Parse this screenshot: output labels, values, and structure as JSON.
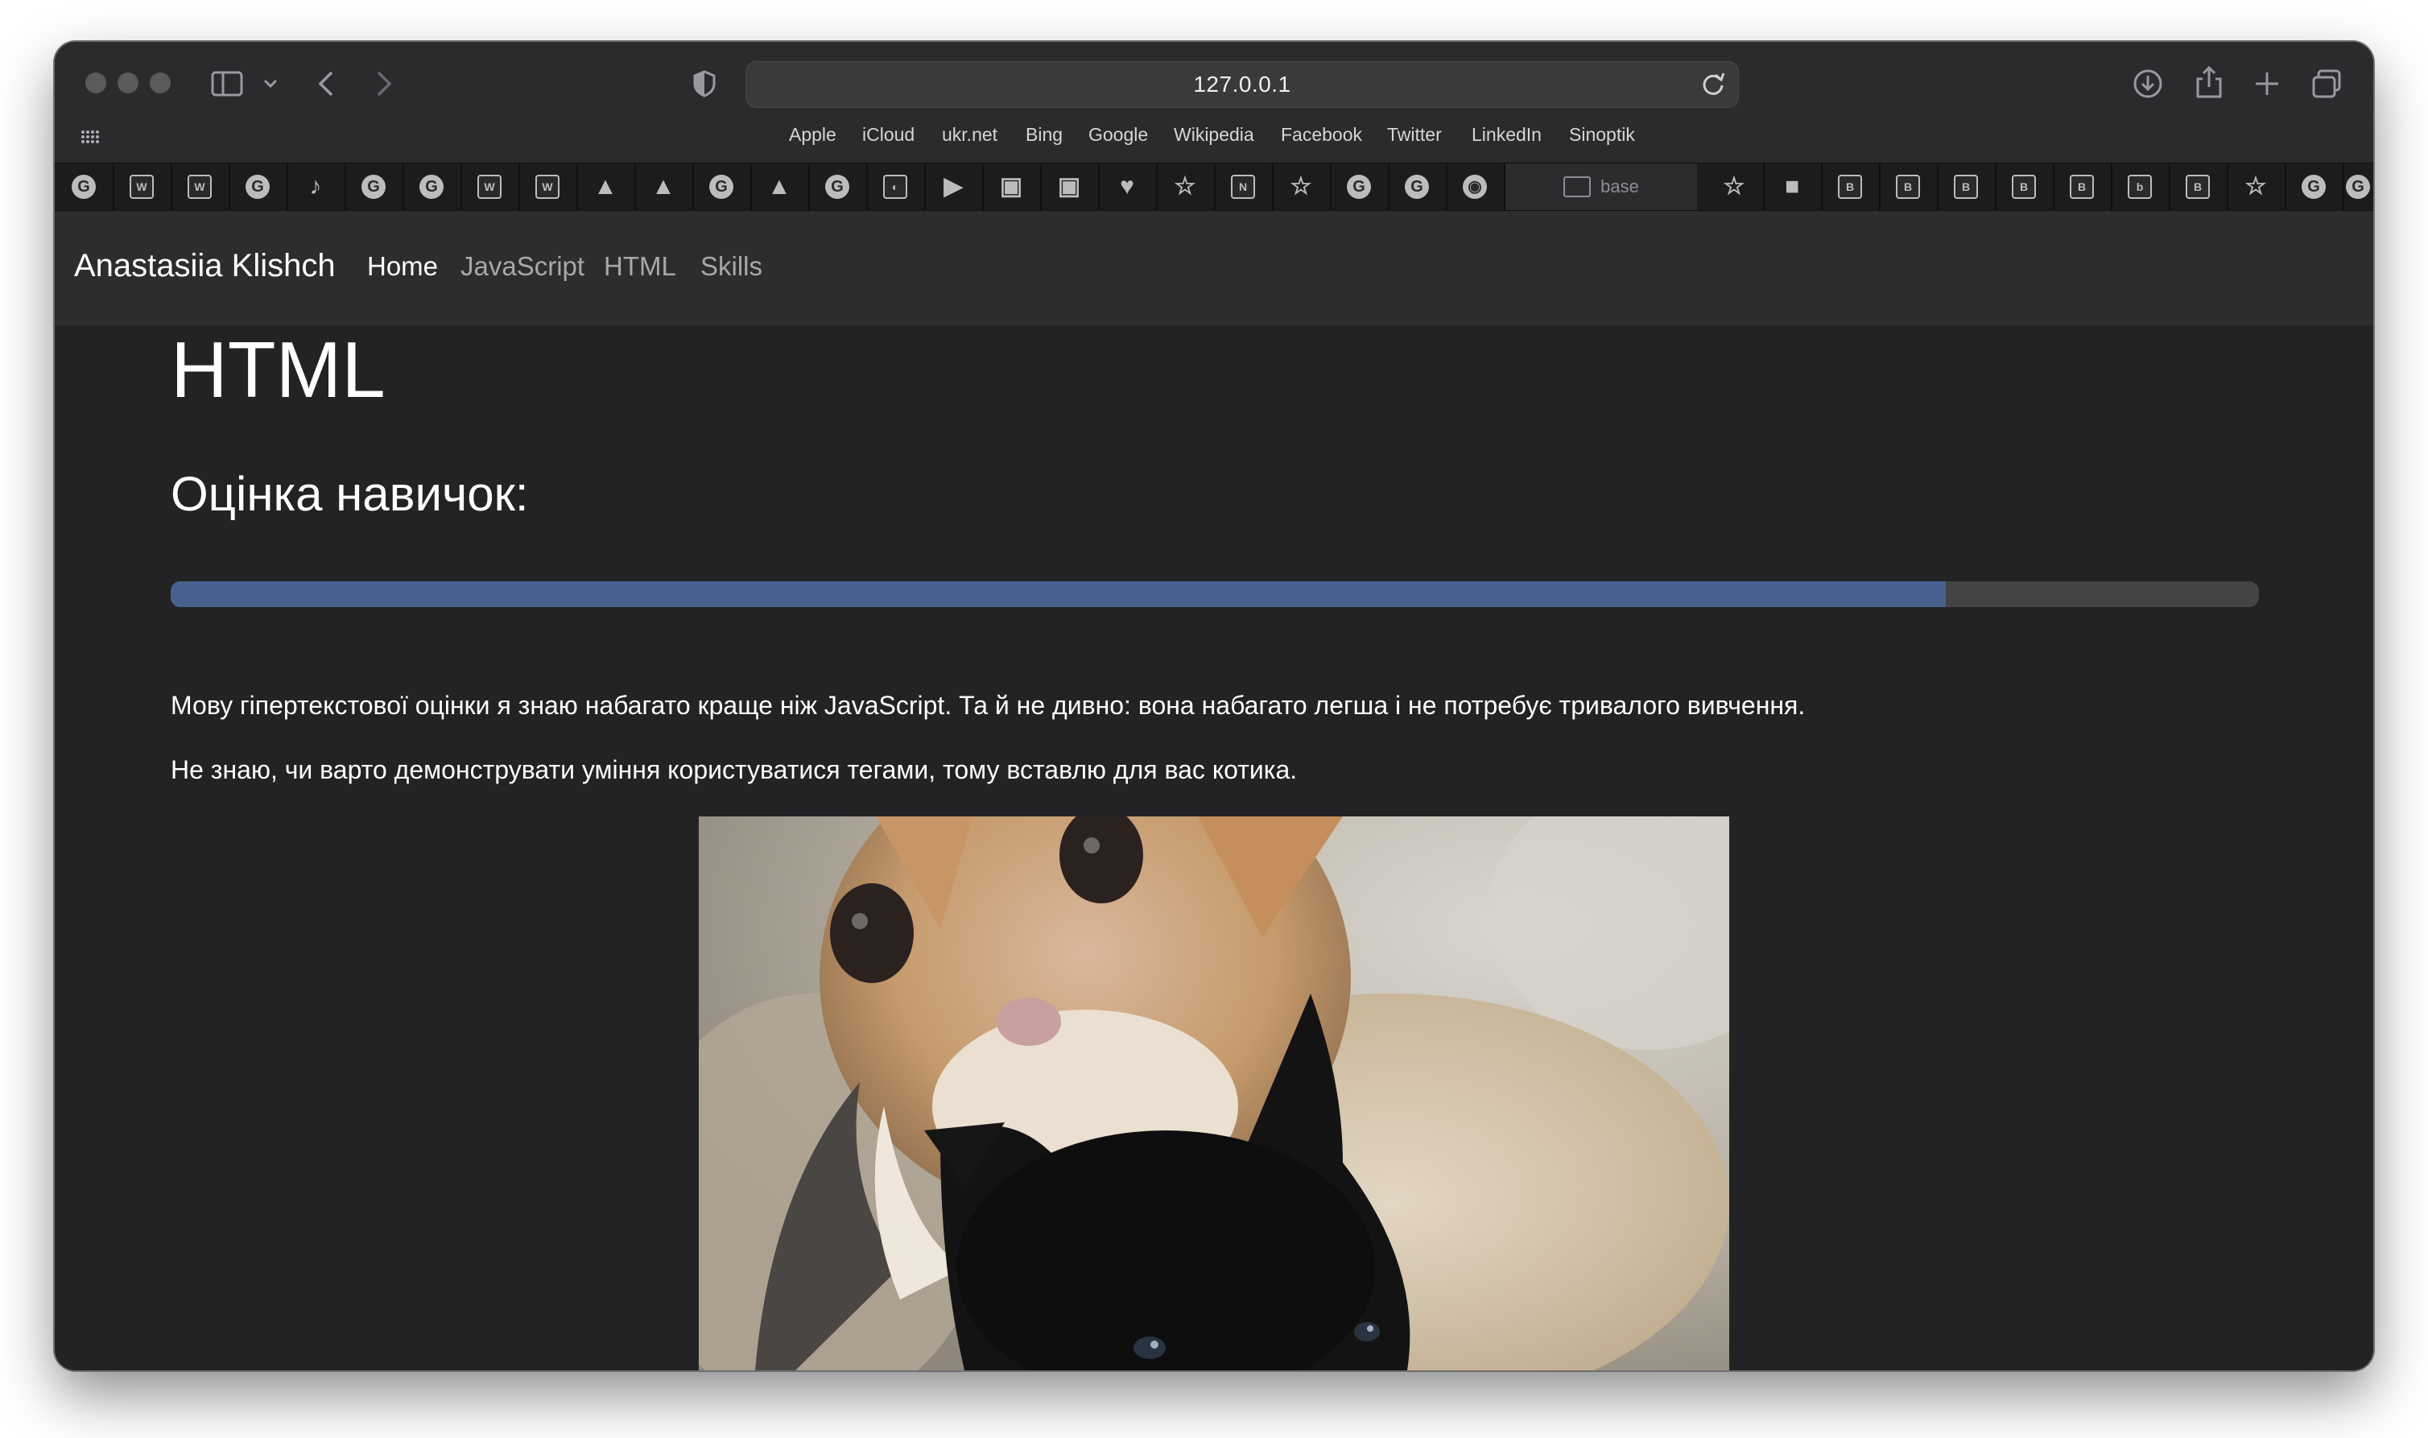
{
  "browser": {
    "url": "127.0.0.1",
    "favorites": [
      "Apple",
      "iCloud",
      "ukr.net",
      "Bing",
      "Google",
      "Wikipedia",
      "Facebook",
      "Twitter",
      "LinkedIn",
      "Sinoptik"
    ],
    "tab_base_label": "base"
  },
  "site": {
    "brand": "Anastasiia Klishch",
    "nav": [
      "Home",
      "JavaScript",
      "HTML",
      "Skills"
    ],
    "active_nav": "Home"
  },
  "page": {
    "title": "HTML",
    "subtitle": "Оцінка навичок:",
    "skill_progress": 0.85,
    "paragraphs": [
      "Мову гіпертекстової оцінки я знаю набагато краще ніж JavaScript. Та й не дивно: вона набагато легша і не потребує тривалого вивчення.",
      "Не знаю, чи варто демонструвати уміння користуватися тегами, тому вставлю для вас котика."
    ]
  },
  "colors": {
    "progress_fill": "#48628f",
    "progress_track": "#444446",
    "page_bg": "#232325",
    "navbar_bg": "#2d2d2f"
  }
}
